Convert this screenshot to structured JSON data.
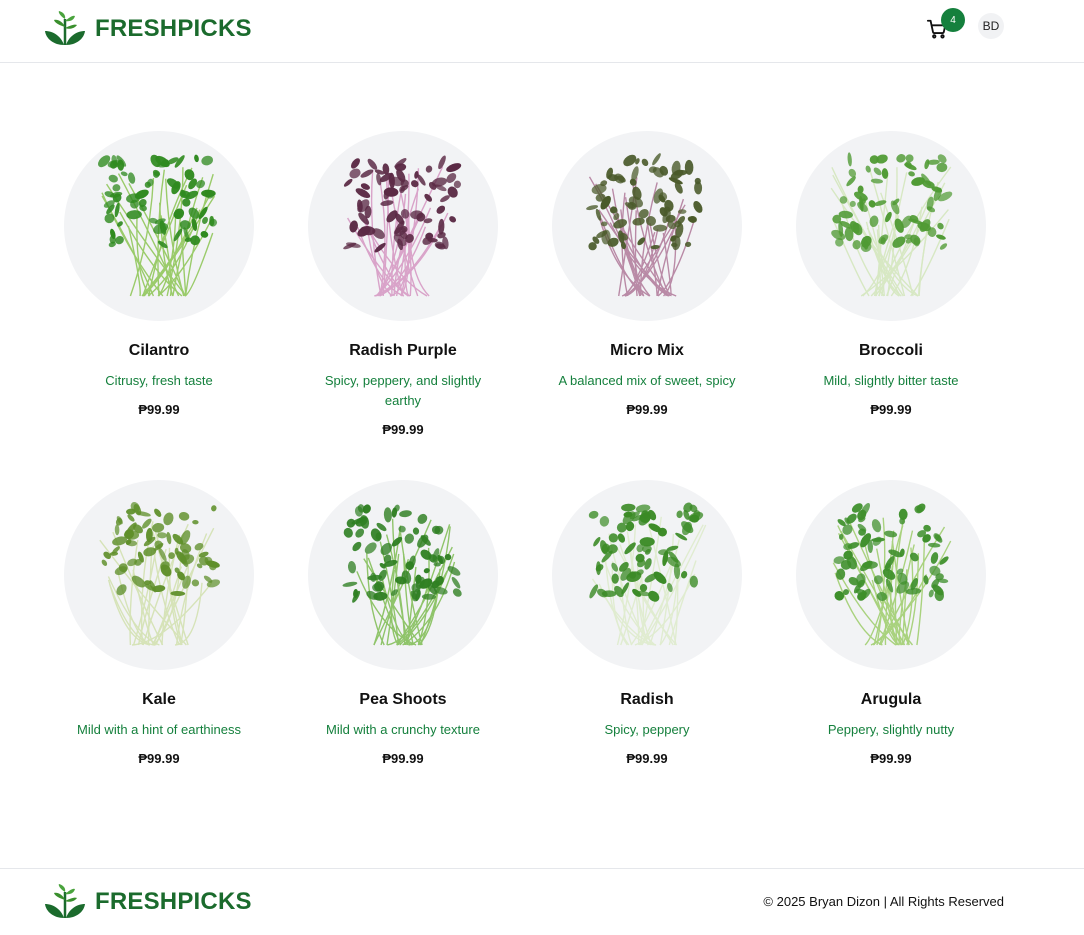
{
  "header": {
    "brand": "FRESHPICKS",
    "cart_count": "4",
    "avatar_initials": "BD"
  },
  "products": [
    {
      "name": "Cilantro",
      "description": "Citrusy, fresh taste",
      "price": "₱99.99",
      "leaf": "#2f8a1f",
      "stem": "#9acb6a"
    },
    {
      "name": "Radish Purple",
      "description": "Spicy, peppery, and slightly earthy",
      "price": "₱99.99",
      "leaf": "#5b2a45",
      "stem": "#d9a3c9"
    },
    {
      "name": "Micro Mix",
      "description": "A balanced mix of sweet, spicy",
      "price": "₱99.99",
      "leaf": "#4a5a2a",
      "stem": "#b98aa6"
    },
    {
      "name": "Broccoli",
      "description": "Mild, slightly bitter taste",
      "price": "₱99.99",
      "leaf": "#4f9a33",
      "stem": "#d7e8c3"
    },
    {
      "name": "Kale",
      "description": "Mild with a hint of earthiness",
      "price": "₱99.99",
      "leaf": "#5f8f2a",
      "stem": "#d6e3b8"
    },
    {
      "name": "Pea Shoots",
      "description": "Mild with a crunchy texture",
      "price": "₱99.99",
      "leaf": "#2f7f22",
      "stem": "#8fc46a"
    },
    {
      "name": "Radish",
      "description": "Spicy, peppery",
      "price": "₱99.99",
      "leaf": "#3a8a25",
      "stem": "#e0ecd0"
    },
    {
      "name": "Arugula",
      "description": "Peppery, slightly nutty",
      "price": "₱99.99",
      "leaf": "#3e8f2b",
      "stem": "#a9d27e"
    }
  ],
  "footer": {
    "brand": "FRESHPICKS",
    "copyright": "© 2025 Bryan Dizon | All Rights Reserved"
  },
  "colors": {
    "brand_green": "#1b6b2d",
    "accent_green": "#15803d",
    "thumb_bg": "#f2f3f5"
  },
  "icons": [
    "sprout-logo-icon",
    "cart-icon"
  ]
}
